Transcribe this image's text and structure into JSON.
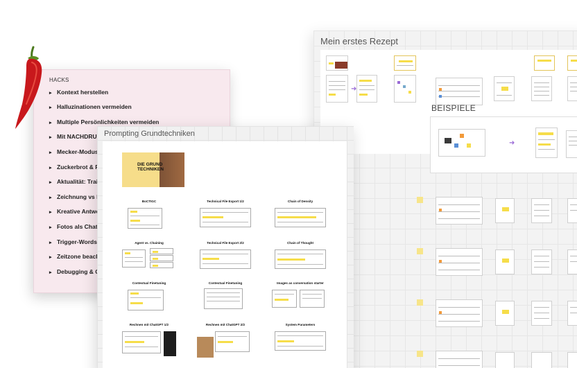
{
  "boards": {
    "right": {
      "title": "Mein erstes Rezept",
      "section_label": "BEISPIELE"
    },
    "hacks": {
      "title": "HACKS",
      "items": [
        "Kontext herstellen",
        "Halluzinationen vermeiden",
        "Multiple Persönlichkeiten vermeiden",
        "Mit NACHDRUC",
        "Mecker-Modus:",
        "Zuckerbrot & Pe",
        "Aktualität: Train",
        "Zeichnung vs D",
        "Kreative Antwo",
        "Fotos als Chat-S",
        "Trigger-Words,",
        "Zeitzone beacht",
        "Debugging & Op"
      ]
    },
    "prompting": {
      "title": "Prompting Grundtechniken",
      "cover": {
        "title_line1": "DIE GRUND",
        "title_line2": "TECHNIKEN"
      },
      "slides": [
        {
          "title": "BoCTIGC"
        },
        {
          "title": "Technical File Export 1/2"
        },
        {
          "title": "Chain of Density"
        },
        {
          "title": "Agent vs. Chaining"
        },
        {
          "title": "Technical File Export 2/2"
        },
        {
          "title": "Chain of Thought"
        },
        {
          "title": "Contextual Finetuning"
        },
        {
          "title": "Contextual Finetuning"
        },
        {
          "title": "Images as conversation starter"
        },
        {
          "title": "Rechnen mit ChatGPT 1/2"
        },
        {
          "title": "Rechnen mit ChatGPT 2/2"
        },
        {
          "title": "System Parameters"
        }
      ]
    }
  },
  "colors": {
    "accent_yellow": "#f6dd4a",
    "hacks_bg": "#f8e9ee",
    "arrow_purple": "#9a6bd6",
    "pepper_red": "#c8181c"
  },
  "icons": {
    "pepper": "chili-pepper-icon",
    "arrow": "arrow-right-icon"
  }
}
